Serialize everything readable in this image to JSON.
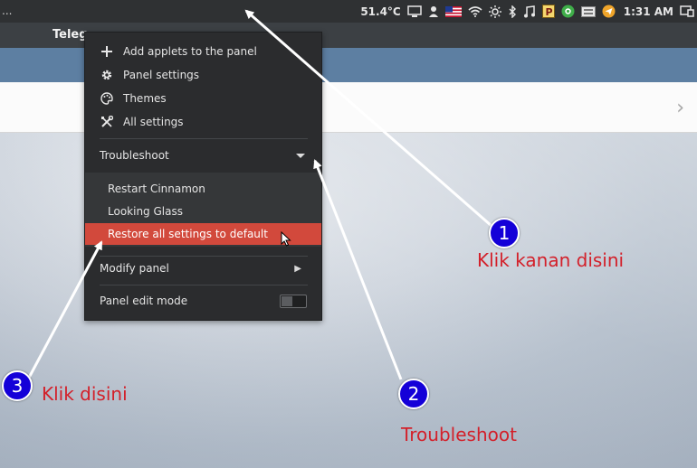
{
  "topbar": {
    "left_text": "...",
    "temperature": "51.4°C",
    "clock": "1:31 AM",
    "tray_icons": [
      "monitor-icon",
      "user-icon",
      "us-flag-icon",
      "wifi-icon",
      "brightness-icon",
      "bluetooth-icon",
      "music-icon",
      "p-app-icon",
      "update-icon",
      "keyboard-icon",
      "telegram-icon",
      "window-list-icon"
    ]
  },
  "app": {
    "title": "Teleg"
  },
  "content": {
    "chevron": "›"
  },
  "menu": {
    "items": [
      {
        "label": "Add applets to the panel",
        "icon": "plus-icon"
      },
      {
        "label": "Panel settings",
        "icon": "gear-icon"
      },
      {
        "label": "Themes",
        "icon": "palette-icon"
      },
      {
        "label": "All settings",
        "icon": "tools-icon"
      }
    ],
    "troubleshoot": "Troubleshoot",
    "sub_items": [
      {
        "label": "Restart Cinnamon"
      },
      {
        "label": "Looking Glass"
      },
      {
        "label": "Restore all settings to default"
      }
    ],
    "modify_panel": "Modify panel",
    "panel_edit_mode": "Panel edit mode"
  },
  "annotations": {
    "badge1": "1",
    "text1": "Klik kanan disini",
    "badge2": "2",
    "text2": "Troubleshoot",
    "badge3": "3",
    "text3": "Klik disini",
    "arrow_color": "#ffffff",
    "text_color": "#d3202a",
    "badge_color": "#1400d8"
  },
  "colors": {
    "highlight": "#d2493c",
    "menu_bg": "#2b2c2e",
    "panel_bg": "#2f3133"
  }
}
